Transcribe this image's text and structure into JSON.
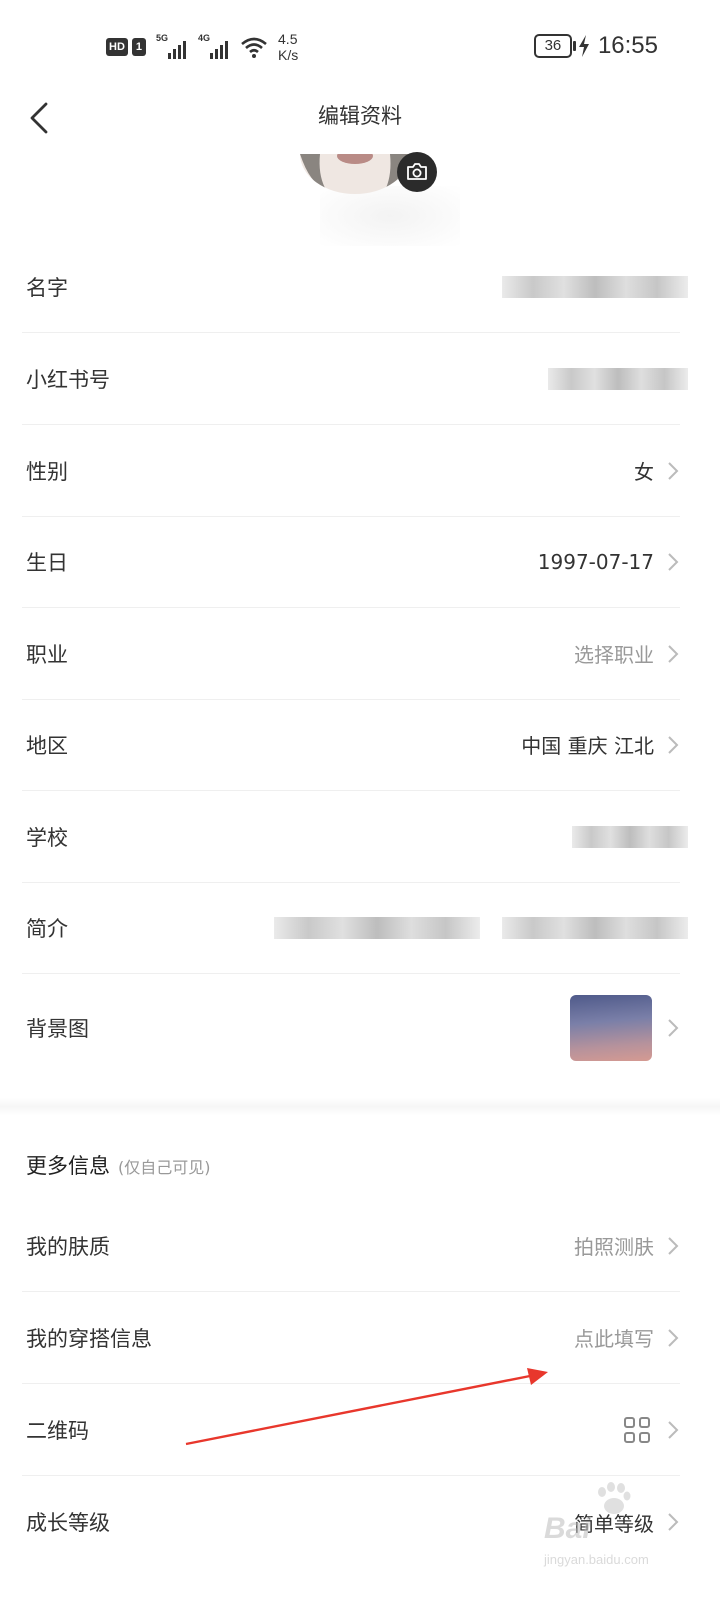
{
  "status_bar": {
    "hd": "HD",
    "sim": "1",
    "net1": "5G",
    "net2": "4G",
    "speed_value": "4.5",
    "speed_unit": "K/s",
    "battery": "36",
    "time": "16:55"
  },
  "header": {
    "title": "编辑资料"
  },
  "profile_rows": [
    {
      "label": "名字",
      "value": ""
    },
    {
      "label": "小红书号",
      "value": ""
    },
    {
      "label": "性别",
      "value": "女"
    },
    {
      "label": "生日",
      "value": "1997-07-17"
    },
    {
      "label": "职业",
      "value": "选择职业"
    },
    {
      "label": "地区",
      "value": "中国 重庆 江北"
    },
    {
      "label": "学校",
      "value": ""
    },
    {
      "label": "简介",
      "value": ""
    },
    {
      "label": "背景图",
      "value": ""
    }
  ],
  "more_info": {
    "title": "更多信息",
    "note": "(仅自己可见)",
    "rows": [
      {
        "label": "我的肤质",
        "value": "拍照测肤"
      },
      {
        "label": "我的穿搭信息",
        "value": "点此填写"
      },
      {
        "label": "二维码",
        "value": ""
      },
      {
        "label": "成长等级",
        "value": "简单等级"
      }
    ]
  },
  "watermark": {
    "text": "Bai",
    "sub": "jingyan.baidu.com"
  },
  "colors": {
    "annotation_arrow": "#e8372c",
    "muted_text": "#999999",
    "divider": "#efefef"
  }
}
